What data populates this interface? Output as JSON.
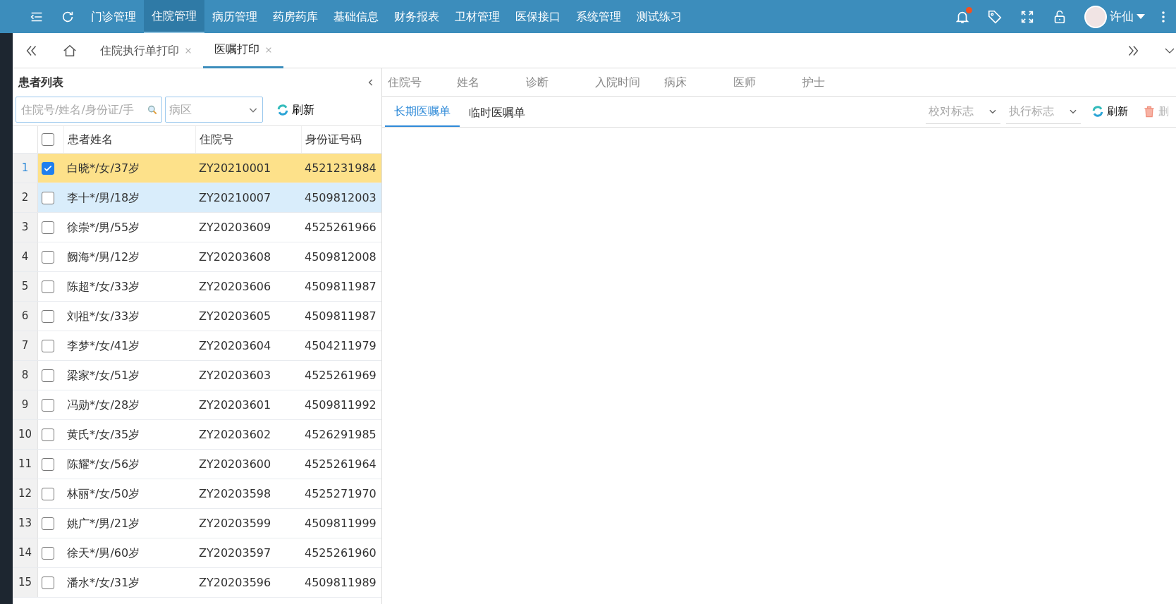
{
  "menu": [
    {
      "label": "门诊管理",
      "selected": false
    },
    {
      "label": "住院管理",
      "selected": true
    },
    {
      "label": "病历管理",
      "selected": false
    },
    {
      "label": "药房药库",
      "selected": false
    },
    {
      "label": "基础信息",
      "selected": false
    },
    {
      "label": "财务报表",
      "selected": false
    },
    {
      "label": "卫材管理",
      "selected": false
    },
    {
      "label": "医保接口",
      "selected": false
    },
    {
      "label": "系统管理",
      "selected": false
    },
    {
      "label": "测试练习",
      "selected": false
    }
  ],
  "user": {
    "name": "许仙",
    "has_notification": true
  },
  "page_tabs": [
    {
      "label": "住院执行单打印",
      "selected": false
    },
    {
      "label": "医嘱打印",
      "selected": true
    }
  ],
  "patient_panel": {
    "title": "患者列表",
    "search": {
      "placeholder": "住院号/姓名/身份证/手"
    },
    "ward": {
      "placeholder": "病区"
    },
    "refresh": "刷新",
    "columns": [
      "患者姓名",
      "住院号",
      "身份证号码"
    ],
    "select_all_checked": false,
    "rows": [
      {
        "no": "1",
        "name": "白晓*/女/37岁",
        "admission_no": "ZY20210001",
        "id_card": "4521231984",
        "checked": true,
        "hovered": false
      },
      {
        "no": "2",
        "name": "李十*/男/18岁",
        "admission_no": "ZY20210007",
        "id_card": "4509812003",
        "checked": false,
        "hovered": true
      },
      {
        "no": "3",
        "name": "徐崇*/男/55岁",
        "admission_no": "ZY20203609",
        "id_card": "4525261966",
        "checked": false,
        "hovered": false
      },
      {
        "no": "4",
        "name": "阙海*/男/12岁",
        "admission_no": "ZY20203608",
        "id_card": "4509812008",
        "checked": false,
        "hovered": false
      },
      {
        "no": "5",
        "name": "陈超*/女/33岁",
        "admission_no": "ZY20203606",
        "id_card": "4509811987",
        "checked": false,
        "hovered": false
      },
      {
        "no": "6",
        "name": "刘祖*/女/33岁",
        "admission_no": "ZY20203605",
        "id_card": "4509811987",
        "checked": false,
        "hovered": false
      },
      {
        "no": "7",
        "name": "李梦*/女/41岁",
        "admission_no": "ZY20203604",
        "id_card": "4504211979",
        "checked": false,
        "hovered": false
      },
      {
        "no": "8",
        "name": "梁家*/女/51岁",
        "admission_no": "ZY20203603",
        "id_card": "4525261969",
        "checked": false,
        "hovered": false
      },
      {
        "no": "9",
        "name": "冯勋*/女/28岁",
        "admission_no": "ZY20203601",
        "id_card": "4509811992",
        "checked": false,
        "hovered": false
      },
      {
        "no": "10",
        "name": "黄氏*/女/35岁",
        "admission_no": "ZY20203602",
        "id_card": "4526291985",
        "checked": false,
        "hovered": false
      },
      {
        "no": "11",
        "name": "陈耀*/女/56岁",
        "admission_no": "ZY20203600",
        "id_card": "4525261964",
        "checked": false,
        "hovered": false
      },
      {
        "no": "12",
        "name": "林丽*/女/50岁",
        "admission_no": "ZY20203598",
        "id_card": "4525271970",
        "checked": false,
        "hovered": false
      },
      {
        "no": "13",
        "name": "姚广*/男/21岁",
        "admission_no": "ZY20203599",
        "id_card": "4509811999",
        "checked": false,
        "hovered": false
      },
      {
        "no": "14",
        "name": "徐天*/男/60岁",
        "admission_no": "ZY20203597",
        "id_card": "4525261960",
        "checked": false,
        "hovered": false
      },
      {
        "no": "15",
        "name": "潘水*/女/31岁",
        "admission_no": "ZY20203596",
        "id_card": "4509811989",
        "checked": false,
        "hovered": false
      }
    ]
  },
  "order_panel": {
    "info_labels": [
      "住院号",
      "姓名",
      "诊断",
      "入院时间",
      "病床",
      "医师",
      "护士"
    ],
    "tabs": [
      {
        "label": "长期医嘱单",
        "selected": true
      },
      {
        "label": "临时医嘱单",
        "selected": false
      }
    ],
    "filters": [
      {
        "placeholder": "校对标志"
      },
      {
        "placeholder": "执行标志"
      }
    ],
    "refresh": "刷新",
    "delete": "删"
  }
}
